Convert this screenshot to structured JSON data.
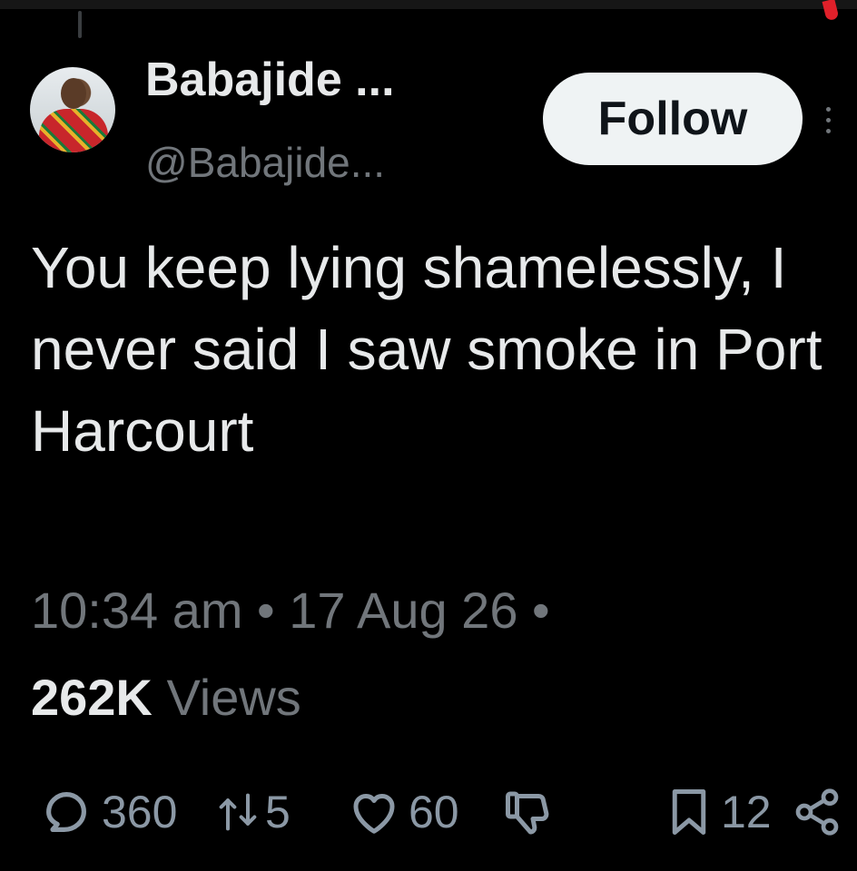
{
  "tweet": {
    "display_name": "Babajide ...",
    "handle": "@Babajide...",
    "follow_label": "Follow",
    "text": "You keep lying shamelessly, I never said I saw smoke in Port Harcourt",
    "meta": "10:34 am • 17 Aug 26 •",
    "views_count": "262K",
    "views_label": "Views"
  },
  "actions": {
    "reply_count": "360",
    "repost_count": "5",
    "like_count": "60",
    "bookmark_count": "12"
  },
  "icons": {
    "avatar": "profile-photo",
    "more": "more-vertical-icon",
    "reply": "reply-icon",
    "repost": "repost-icon",
    "like": "heart-icon",
    "dislike": "thumbs-down-icon",
    "bookmark": "bookmark-icon",
    "share": "share-icon"
  },
  "colors": {
    "background": "#000000",
    "text_primary": "#e7e9ea",
    "text_secondary": "#71767b",
    "follow_bg": "#eff3f4"
  }
}
